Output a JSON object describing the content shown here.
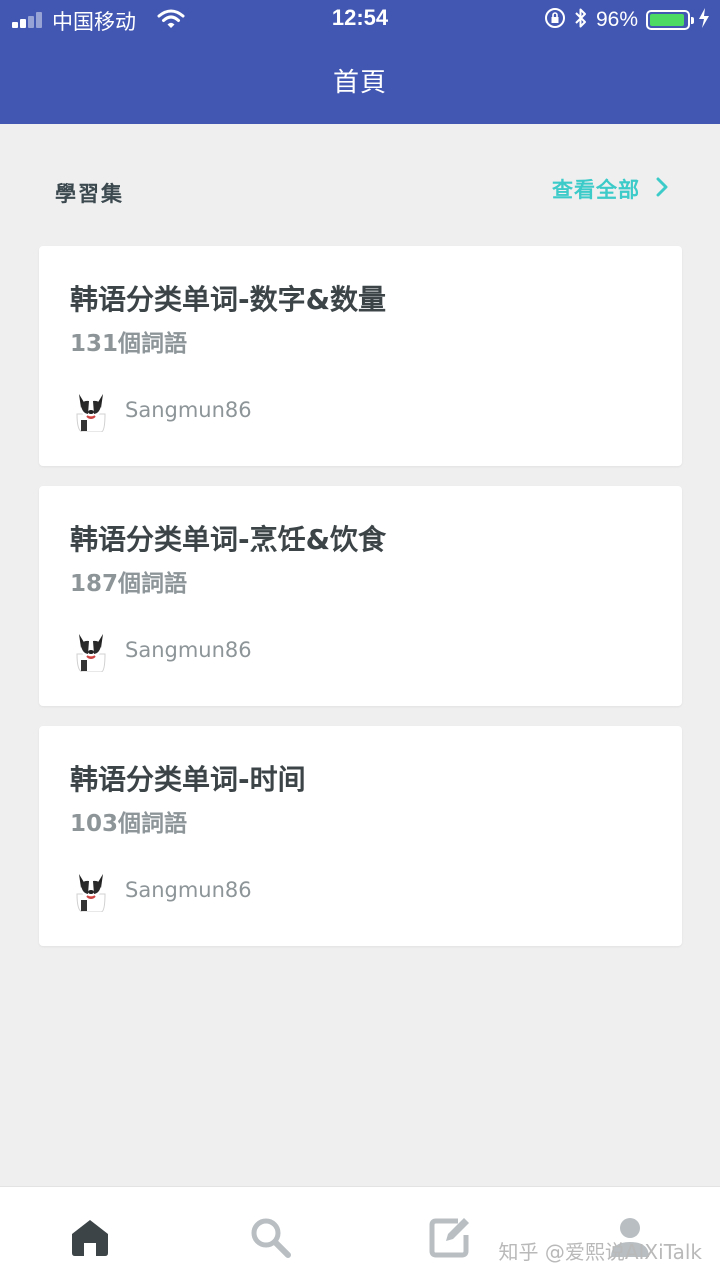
{
  "status_bar": {
    "carrier": "中国移动",
    "time": "12:54",
    "battery_pct": "96%",
    "battery_color": "#4cd964"
  },
  "header": {
    "title": "首頁",
    "bg_color": "#4257b2"
  },
  "section": {
    "title": "學習集",
    "see_all_label": "查看全部",
    "accent_color": "#3ccbc9"
  },
  "cards": [
    {
      "title": "韩语分类单词-数字&数量",
      "count": "131個詞語",
      "author": "Sangmun86"
    },
    {
      "title": "韩语分类单词-烹饪&饮食",
      "count": "187個詞語",
      "author": "Sangmun86"
    },
    {
      "title": "韩语分类单词-时间",
      "count": "103個詞語",
      "author": "Sangmun86"
    }
  ],
  "tabs": [
    {
      "icon": "home-icon",
      "active": true
    },
    {
      "icon": "search-icon",
      "active": false
    },
    {
      "icon": "edit-icon",
      "active": false
    },
    {
      "icon": "profile-icon",
      "active": false
    }
  ],
  "watermark": "知乎 @爱熙说AIXiTalk"
}
